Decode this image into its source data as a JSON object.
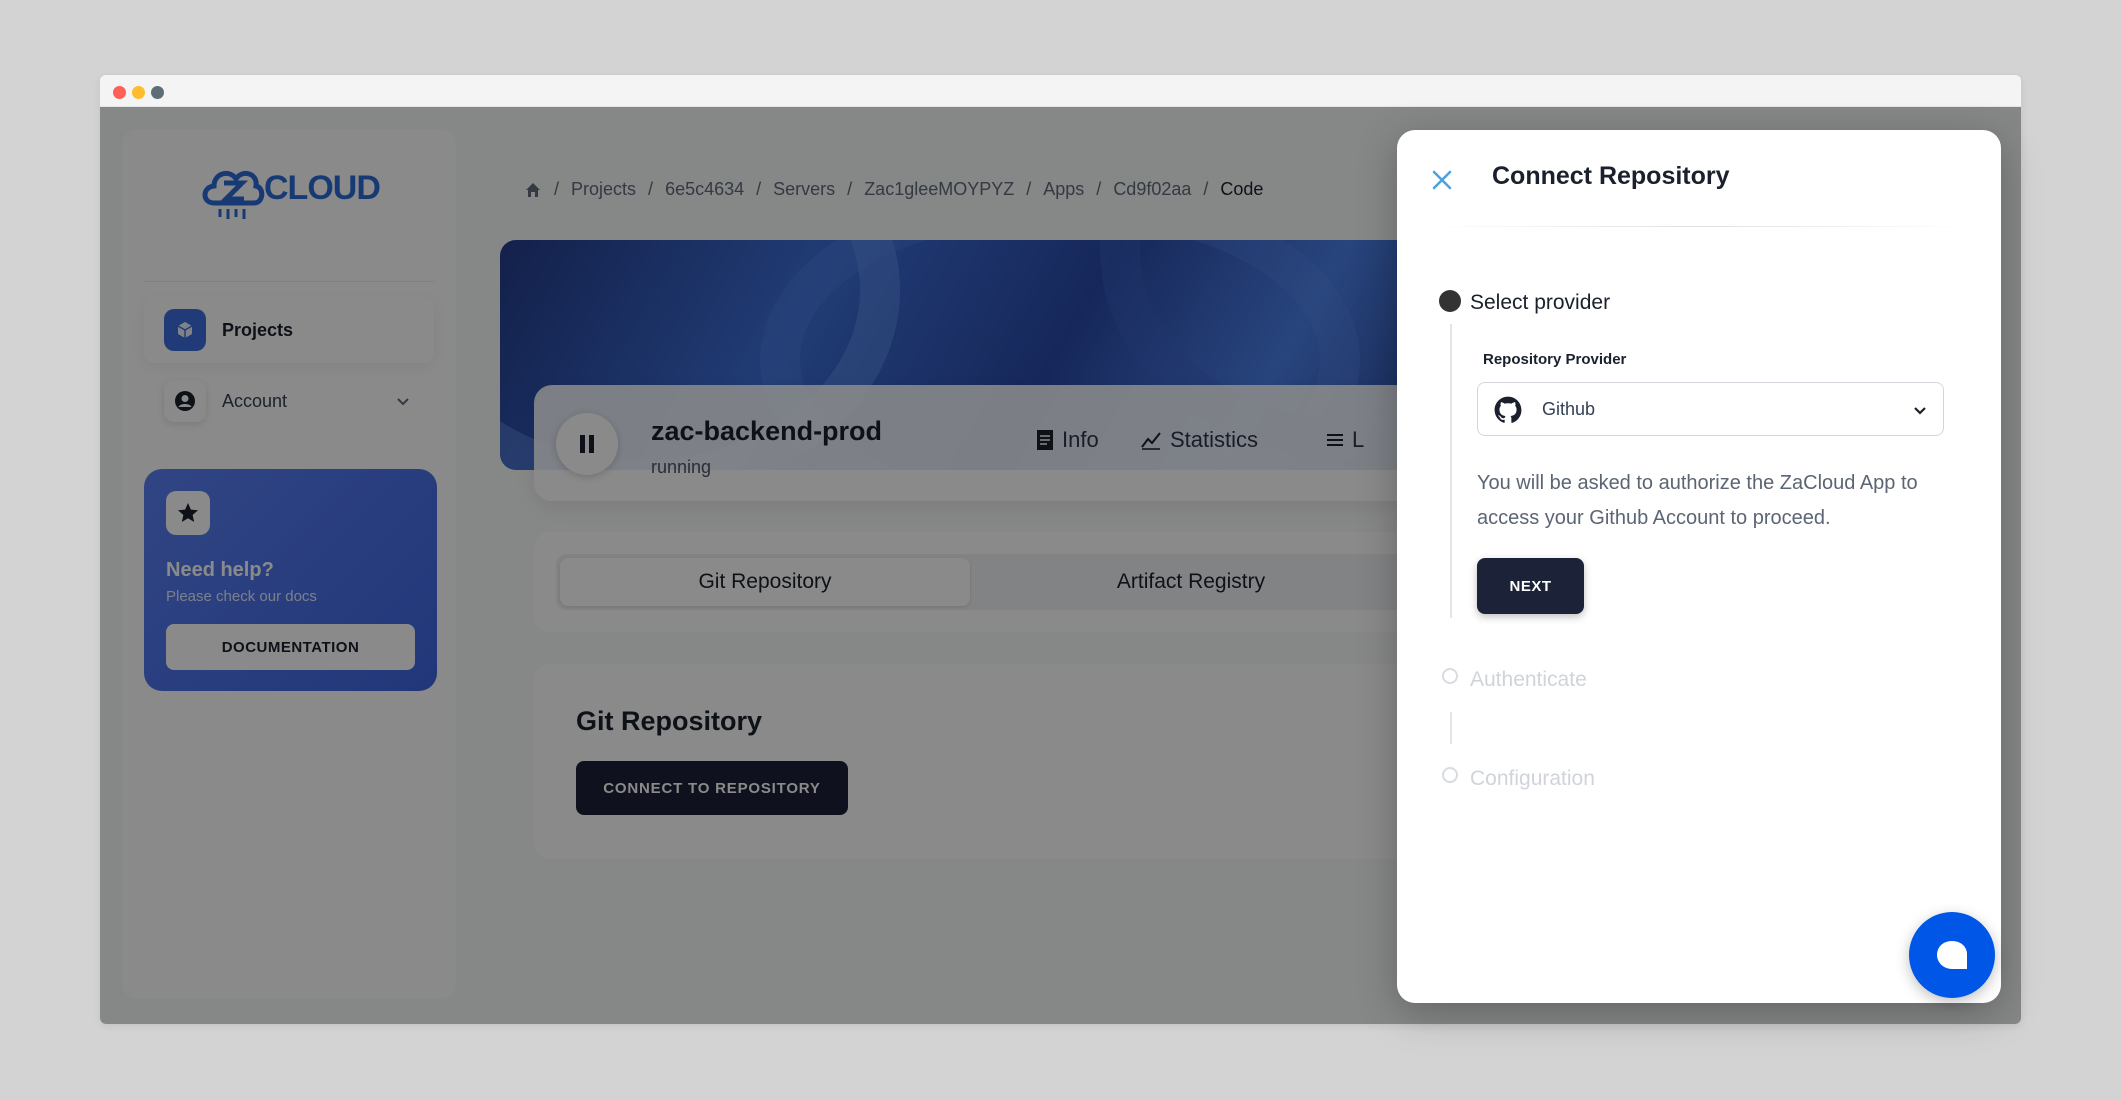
{
  "sidebar": {
    "logo_text": "CLOUD",
    "items": [
      {
        "label": "Projects"
      },
      {
        "label": "Account"
      }
    ],
    "help": {
      "title": "Need help?",
      "subtitle": "Please check our docs",
      "button": "DOCUMENTATION"
    }
  },
  "breadcrumb": [
    "Projects",
    "6e5c4634",
    "Servers",
    "Zac1gleeMOYPYZ",
    "Apps",
    "Cd9f02aa",
    "Code"
  ],
  "server": {
    "name": "zac-backend-prod",
    "status": "running",
    "tabs": [
      {
        "label": "Info"
      },
      {
        "label": "Statistics"
      },
      {
        "label": "L"
      }
    ]
  },
  "registry_tabs": [
    "Git Repository",
    "Artifact Registry"
  ],
  "git_card": {
    "title": "Git Repository",
    "button": "CONNECT TO REPOSITORY"
  },
  "drawer": {
    "title": "Connect Repository",
    "steps": [
      {
        "label": "Select provider",
        "state": "active"
      },
      {
        "label": "Authenticate",
        "state": "disabled"
      },
      {
        "label": "Configuration",
        "state": "disabled"
      }
    ],
    "field_label": "Repository Provider",
    "selected_provider": "Github",
    "info_text": "You will be asked to authorize the ZaCloud App to access your Github Account to proceed.",
    "next_button": "NEXT"
  },
  "colors": {
    "accent": "#3d6ee0",
    "dark_button": "#1c2238",
    "close_icon": "#4aa3df",
    "chat": "#0057e7"
  }
}
